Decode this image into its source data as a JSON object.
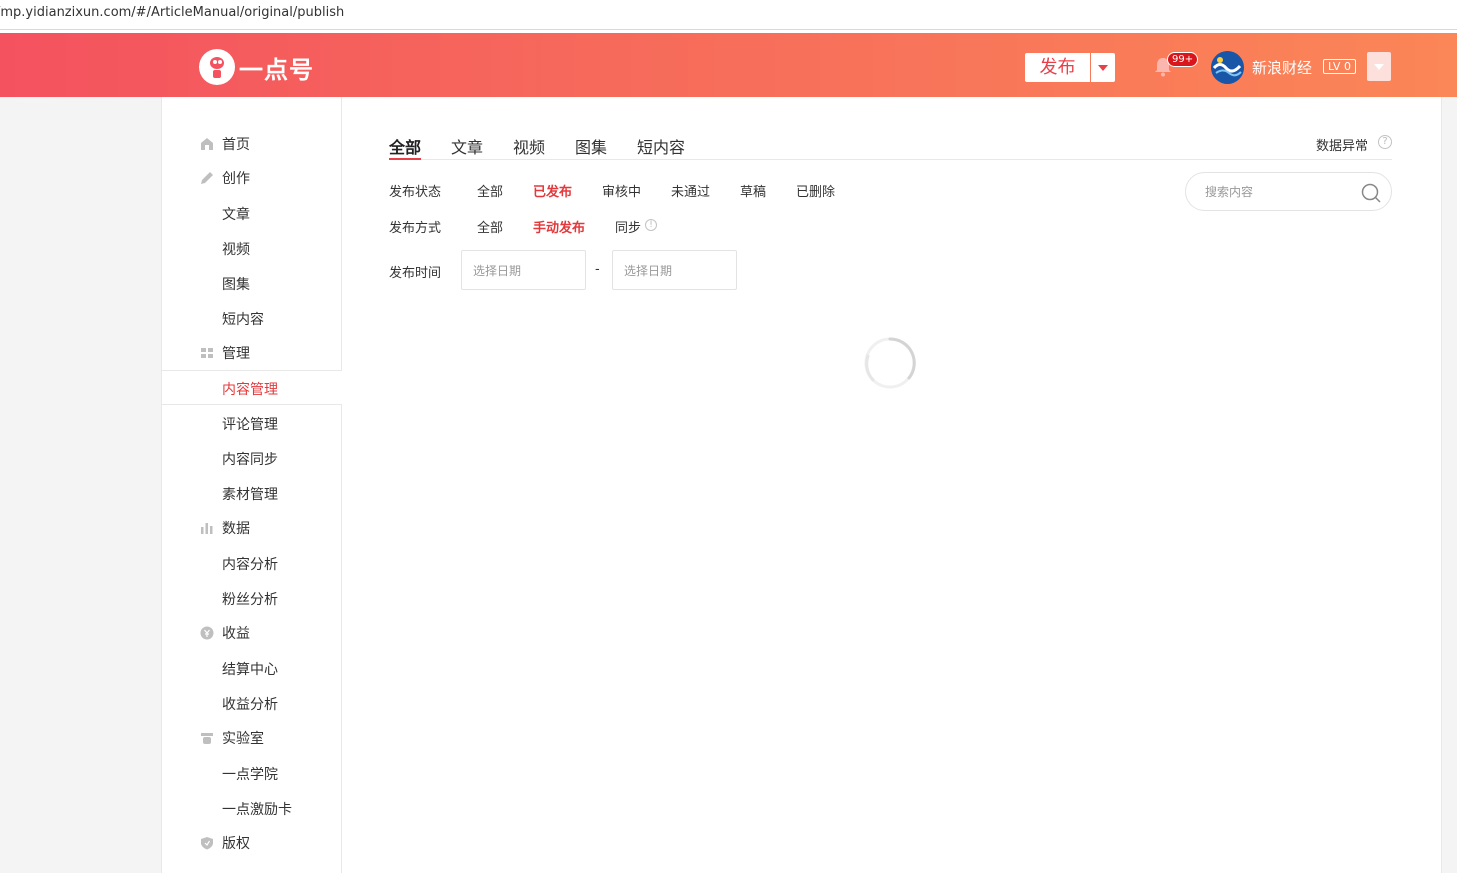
{
  "browser": {
    "url": "/mp.yidianzixun.com/#/ArticleManual/original/publish"
  },
  "header": {
    "logo_text": "一点号",
    "publish_label": "发布",
    "notification_count": "99+",
    "username": "新浪财经",
    "level": "LV 0"
  },
  "sidebar": {
    "items": [
      {
        "label": "首页",
        "icon": "home-icon"
      },
      {
        "label": "创作",
        "icon": "pen-icon"
      },
      {
        "label": "文章"
      },
      {
        "label": "视频"
      },
      {
        "label": "图集"
      },
      {
        "label": "短内容"
      },
      {
        "label": "管理",
        "icon": "grid-icon"
      },
      {
        "label": "内容管理",
        "active": true
      },
      {
        "label": "评论管理"
      },
      {
        "label": "内容同步"
      },
      {
        "label": "素材管理"
      },
      {
        "label": "数据",
        "icon": "bar-chart-icon"
      },
      {
        "label": "内容分析"
      },
      {
        "label": "粉丝分析"
      },
      {
        "label": "收益",
        "icon": "coin-icon"
      },
      {
        "label": "结算中心"
      },
      {
        "label": "收益分析"
      },
      {
        "label": "实验室",
        "icon": "lab-icon"
      },
      {
        "label": "一点学院"
      },
      {
        "label": "一点激励卡"
      },
      {
        "label": "版权",
        "icon": "shield-icon"
      }
    ]
  },
  "main": {
    "tabs": [
      "全部",
      "文章",
      "视频",
      "图集",
      "短内容"
    ],
    "active_tab": "全部",
    "data_abnormal": "数据异常",
    "filters": {
      "status_label": "发布状态",
      "status_options": [
        "全部",
        "已发布",
        "审核中",
        "未通过",
        "草稿",
        "已删除"
      ],
      "status_selected": "已发布",
      "method_label": "发布方式",
      "method_options": [
        "全部",
        "手动发布",
        "同步"
      ],
      "method_selected": "手动发布",
      "time_label": "发布时间",
      "start_placeholder": "选择日期",
      "end_placeholder": "选择日期",
      "separator": "-"
    },
    "search": {
      "placeholder": "搜索内容"
    }
  },
  "colors": {
    "accent": "#e4393c",
    "header_start": "#f4525f",
    "header_end": "#fb8657"
  }
}
